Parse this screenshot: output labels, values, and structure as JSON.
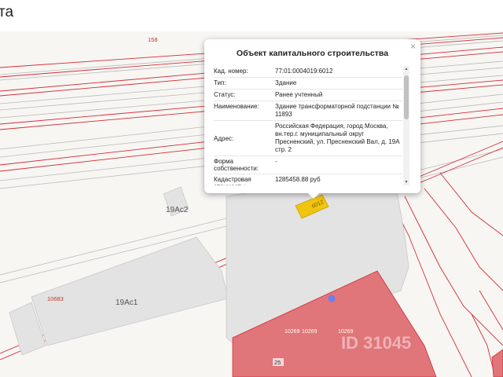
{
  "header": {
    "title": "та"
  },
  "map": {
    "labels": {
      "road_158": "158",
      "building_19ac2": "19Ac2",
      "building_19ac1": "19Ac1",
      "road_10683": "10683",
      "parcel_10269_a": "10269",
      "parcel_10269_b": "10269",
      "parcel_10269_c": "10269",
      "house_25": "25",
      "marker": "6012"
    },
    "watermark": "ID 31045",
    "colors": {
      "parcel_red": "#e0757a",
      "line_red": "#d52b36",
      "building_gray": "#e3e3e3",
      "marker_yellow": "#f1c40f"
    }
  },
  "popup": {
    "title": "Объект капитального строительства",
    "close": "×",
    "rows": [
      {
        "key": "Кад. номер:",
        "value": "77:01:0004019:6012"
      },
      {
        "key": "Тип:",
        "value": "Здание"
      },
      {
        "key": "Статус:",
        "value": "Ранее учтенный"
      },
      {
        "key": "Наименование:",
        "value": "Здание трансформаторной подстанции № 11893"
      },
      {
        "key": "Адрес:",
        "value": "Российская Федерация, город Москва, вн.тер.г. муниципальный округ Пресненский, ул. Пресненский Вал, д. 19А стр. 2"
      },
      {
        "key": "Форма собственности:",
        "value": "-"
      },
      {
        "key": "Кадастровая стоимость:",
        "value": "1285458.88 руб"
      }
    ]
  }
}
